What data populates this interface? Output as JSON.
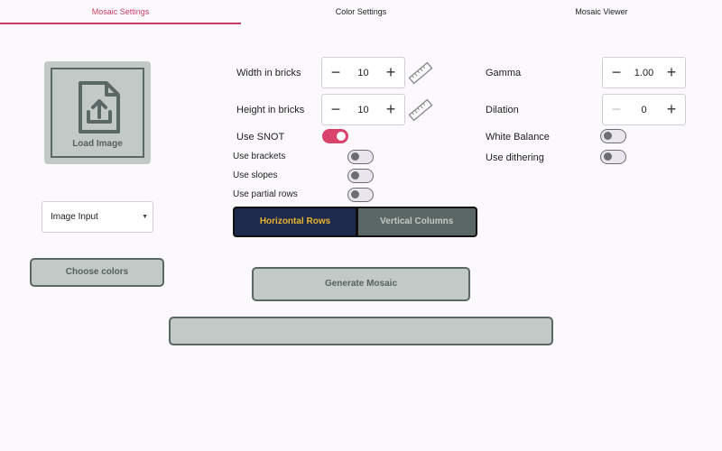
{
  "tabs": [
    {
      "label": "Mosaic Settings",
      "active": true
    },
    {
      "label": "Color Settings",
      "active": false
    },
    {
      "label": "Mosaic Viewer",
      "active": false
    }
  ],
  "image_loader": {
    "label": "Load Image",
    "icon": "file-upload-icon"
  },
  "image_input_select": {
    "selected": "Image Input"
  },
  "choose_colors_button": {
    "label": "Choose colors"
  },
  "generate_button": {
    "label": "Generate Mosaic"
  },
  "width": {
    "label": "Width in bricks",
    "value": "10"
  },
  "height": {
    "label": "Height in bricks",
    "value": "10"
  },
  "options": {
    "use_snot": {
      "label": "Use SNOT",
      "on": true
    },
    "use_brackets": {
      "label": "Use brackets",
      "on": false
    },
    "use_slopes": {
      "label": "Use slopes",
      "on": false
    },
    "use_partial_rows": {
      "label": "Use partial rows",
      "on": false
    },
    "white_balance": {
      "label": "White Balance",
      "on": false
    },
    "use_dithering": {
      "label": "Use dithering",
      "on": false
    }
  },
  "orientation": {
    "left": "Horizontal Rows",
    "right": "Vertical Columns",
    "selected": "left"
  },
  "gamma": {
    "label": "Gamma",
    "value": "1.00"
  },
  "dilation": {
    "label": "Dilation",
    "value": "0"
  },
  "stepper_glyphs": {
    "minus": "−",
    "plus": "+"
  },
  "colors": {
    "accent": "#c93d63",
    "toggle_on": "#d9426a",
    "button_fill": "#c2c9c6",
    "button_border": "#5b6764",
    "segment_selected": "#1d2a4e",
    "segment_selected_text": "#e8b32e"
  }
}
